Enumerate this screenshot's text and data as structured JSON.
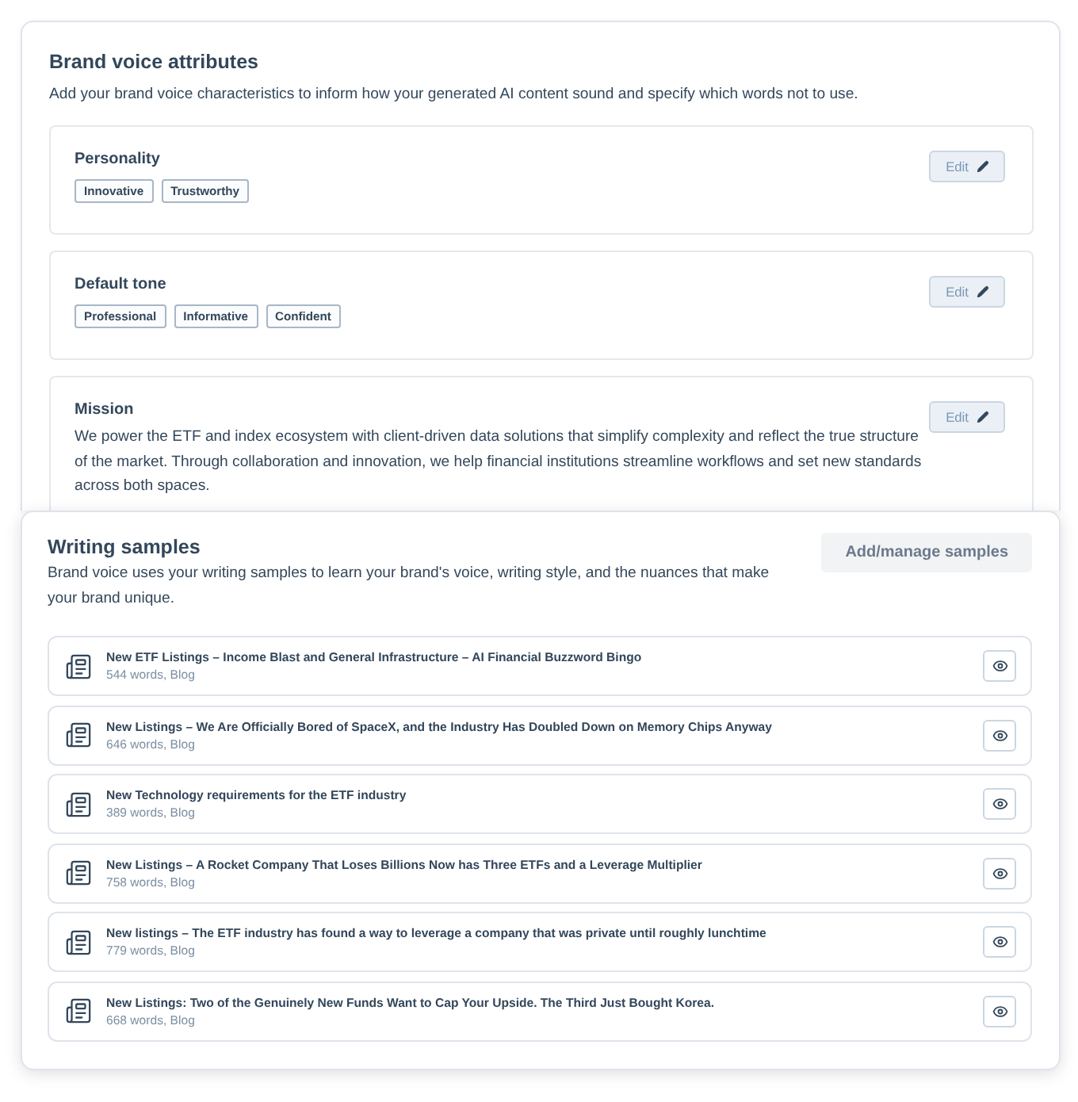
{
  "brand_voice": {
    "title": "Brand voice attributes",
    "description": "Add your brand voice characteristics to inform how your generated AI content sound and specify which words not to use.",
    "attributes": [
      {
        "kind": "tags",
        "title": "Personality",
        "tags": [
          "Innovative",
          "Trustworthy"
        ],
        "edit_label": "Edit"
      },
      {
        "kind": "tags",
        "title": "Default tone",
        "tags": [
          "Professional",
          "Informative",
          "Confident"
        ],
        "edit_label": "Edit"
      },
      {
        "kind": "text",
        "title": "Mission",
        "text": "We power the ETF and index ecosystem with client-driven data solutions that simplify complexity and reflect the true structure of the market. Through collaboration and innovation, we help financial institutions streamline workflows and set new standards across both spaces.",
        "edit_label": "Edit"
      }
    ]
  },
  "writing_samples": {
    "title": "Writing samples",
    "description": "Brand voice uses your writing samples to learn your brand's voice, writing style, and the nuances that make your brand unique.",
    "add_button": {
      "label": "Add/manage samples",
      "disabled": true
    },
    "samples": [
      {
        "title": "New ETF Listings – Income Blast and General Infrastructure – AI Financial Buzzword Bingo",
        "meta": "544 words, Blog"
      },
      {
        "title": "New Listings – We Are Officially Bored of SpaceX, and the Industry Has Doubled Down on Memory Chips Anyway",
        "meta": "646 words, Blog"
      },
      {
        "title": "New Technology requirements for the ETF industry",
        "meta": "389 words, Blog"
      },
      {
        "title": "New Listings – A Rocket Company That Loses Billions Now has Three ETFs and a Leverage Multiplier",
        "meta": "758 words, Blog"
      },
      {
        "title": "New listings – The ETF industry has found a way to leverage a company that was private until roughly lunchtime",
        "meta": "779 words, Blog"
      },
      {
        "title": "New Listings: Two of the Genuinely New Funds Want to Cap Your Upside. The Third Just Bought Korea.",
        "meta": "668 words, Blog"
      }
    ]
  }
}
